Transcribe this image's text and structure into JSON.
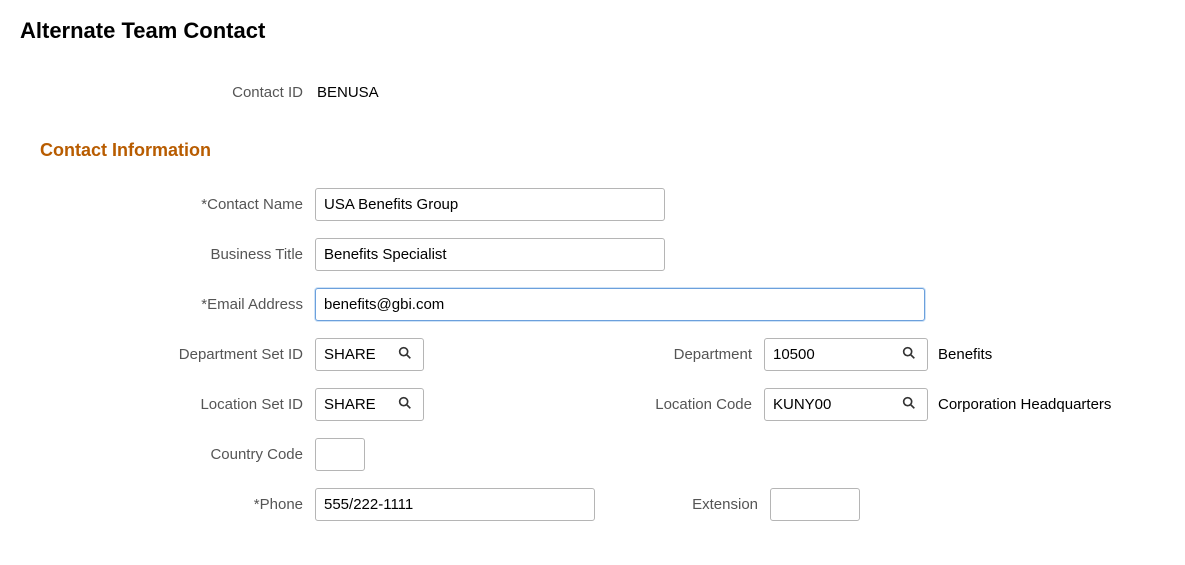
{
  "pageTitle": "Alternate Team Contact",
  "header": {
    "contactIdLabel": "Contact ID",
    "contactIdValue": "BENUSA"
  },
  "section": {
    "title": "Contact Information",
    "contactName": {
      "label": "Contact Name",
      "value": "USA Benefits Group"
    },
    "businessTitle": {
      "label": "Business Title",
      "value": "Benefits Specialist"
    },
    "emailAddress": {
      "label": "Email Address",
      "value": "benefits@gbi.com"
    },
    "deptSetId": {
      "label": "Department Set ID",
      "value": "SHARE"
    },
    "department": {
      "label": "Department",
      "value": "10500",
      "desc": "Benefits"
    },
    "locSetId": {
      "label": "Location Set ID",
      "value": "SHARE"
    },
    "locationCode": {
      "label": "Location Code",
      "value": "KUNY00",
      "desc": "Corporation Headquarters"
    },
    "countryCode": {
      "label": "Country Code",
      "value": ""
    },
    "phone": {
      "label": "Phone",
      "value": "555/222-1111"
    },
    "extension": {
      "label": "Extension",
      "value": ""
    }
  }
}
